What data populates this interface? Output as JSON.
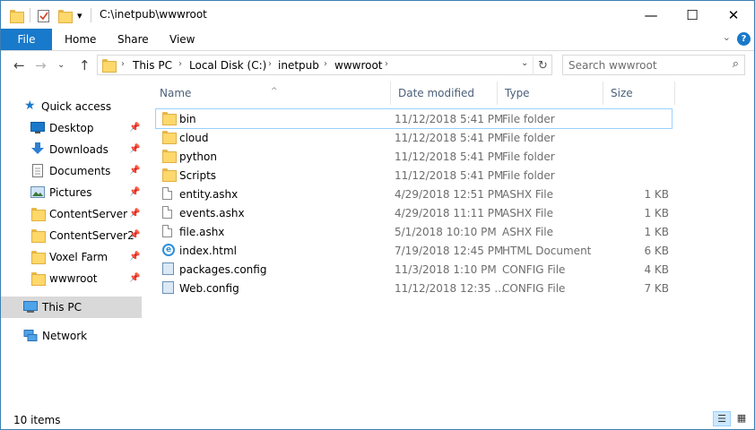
{
  "window": {
    "title": "C:\\inetpub\\wwwroot",
    "minimize": "—",
    "maximize": "☐",
    "close": "✕"
  },
  "quick_access_toolbar": {
    "folder_icon": "folder-icon",
    "properties_icon": "properties-icon",
    "new_folder_icon": "new-folder-icon",
    "customize": "▾"
  },
  "ribbon": {
    "tabs": [
      "File",
      "Home",
      "Share",
      "View"
    ],
    "expand": "⌄",
    "help": "?"
  },
  "address_bar": {
    "back": "←",
    "forward": "→",
    "recent": "⌄",
    "up": "↑",
    "breadcrumbs": [
      "This PC",
      "Local Disk (C:)",
      "inetpub",
      "wwwroot"
    ],
    "dropdown": "⌄",
    "refresh": "↻"
  },
  "search": {
    "placeholder": "Search wwwroot"
  },
  "nav_pane": {
    "quick_access": "Quick access",
    "pinned": [
      {
        "label": "Desktop",
        "icon": "desktop-icon"
      },
      {
        "label": "Downloads",
        "icon": "downloads-icon"
      },
      {
        "label": "Documents",
        "icon": "documents-icon"
      },
      {
        "label": "Pictures",
        "icon": "pictures-icon"
      },
      {
        "label": "ContentServer",
        "icon": "folder-icon"
      },
      {
        "label": "ContentServer2",
        "icon": "folder-icon"
      },
      {
        "label": "Voxel Farm",
        "icon": "folder-icon"
      },
      {
        "label": "wwwroot",
        "icon": "folder-icon"
      }
    ],
    "this_pc": "This PC",
    "network": "Network"
  },
  "columns": {
    "name": "Name",
    "date": "Date modified",
    "type": "Type",
    "size": "Size"
  },
  "files": [
    {
      "name": "bin",
      "date": "11/12/2018 5:41 PM",
      "type": "File folder",
      "size": "",
      "icon": "folder-icon"
    },
    {
      "name": "cloud",
      "date": "11/12/2018 5:41 PM",
      "type": "File folder",
      "size": "",
      "icon": "folder-icon"
    },
    {
      "name": "python",
      "date": "11/12/2018 5:41 PM",
      "type": "File folder",
      "size": "",
      "icon": "folder-icon"
    },
    {
      "name": "Scripts",
      "date": "11/12/2018 5:41 PM",
      "type": "File folder",
      "size": "",
      "icon": "folder-icon"
    },
    {
      "name": "entity.ashx",
      "date": "4/29/2018 12:51 PM",
      "type": "ASHX File",
      "size": "1 KB",
      "icon": "document-icon"
    },
    {
      "name": "events.ashx",
      "date": "4/29/2018 11:11 PM",
      "type": "ASHX File",
      "size": "1 KB",
      "icon": "document-icon"
    },
    {
      "name": "file.ashx",
      "date": "5/1/2018 10:10 PM",
      "type": "ASHX File",
      "size": "1 KB",
      "icon": "document-icon"
    },
    {
      "name": "index.html",
      "date": "7/19/2018 12:45 PM",
      "type": "HTML Document",
      "size": "6 KB",
      "icon": "html-icon"
    },
    {
      "name": "packages.config",
      "date": "11/3/2018 1:10 PM",
      "type": "CONFIG File",
      "size": "4 KB",
      "icon": "config-icon"
    },
    {
      "name": "Web.config",
      "date": "11/12/2018 12:35 ...",
      "type": "CONFIG File",
      "size": "7 KB",
      "icon": "config-icon"
    }
  ],
  "status": {
    "item_count": "10 items"
  },
  "colors": {
    "accent": "#1979ca",
    "selection": "#cce8ff",
    "header_text": "#4c607a",
    "meta_text": "#6d6d6d"
  }
}
